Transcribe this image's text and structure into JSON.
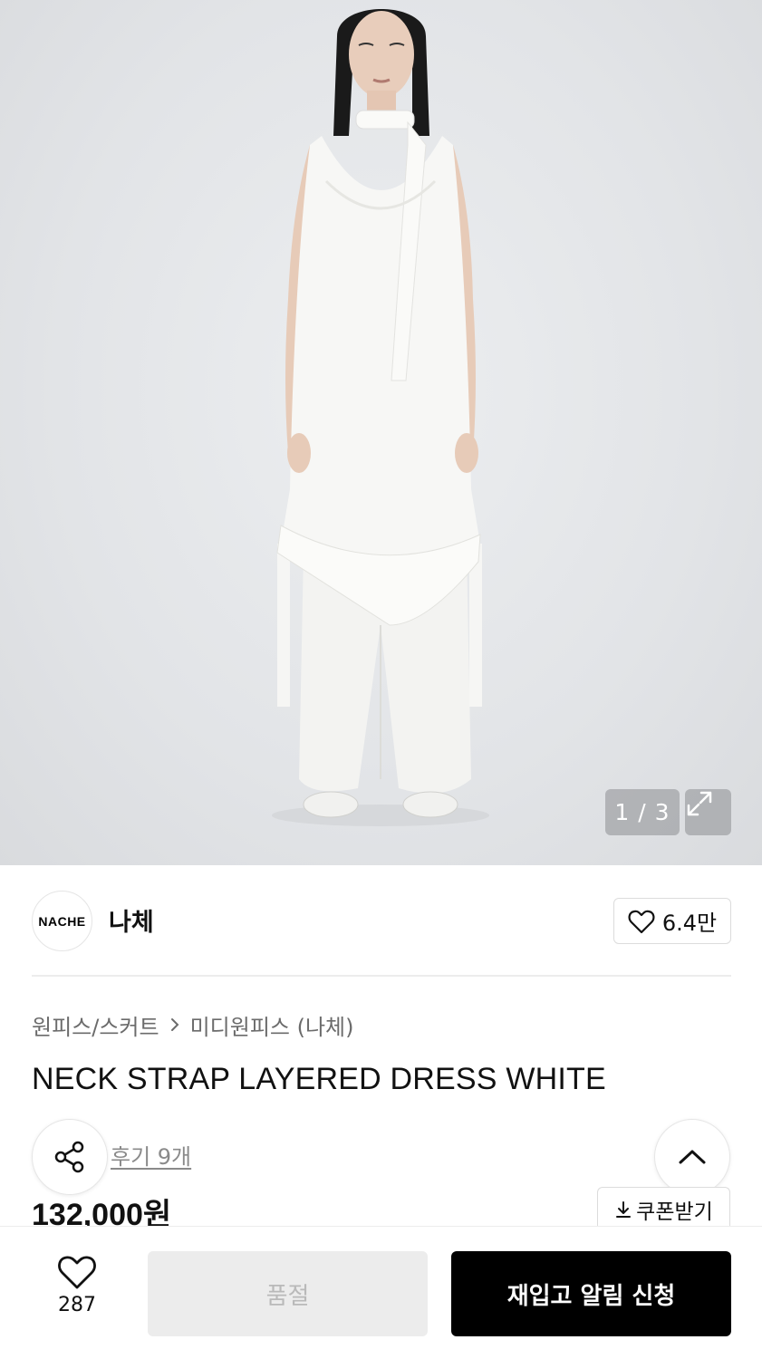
{
  "gallery": {
    "image_alt": "model wearing white layered dress with neck strap over wide white pants",
    "counter": "1 / 3",
    "expand_icon": "expand-icon"
  },
  "brand": {
    "logo_text": "NACHE",
    "name": "나체",
    "like_count": "6.4만",
    "like_icon": "heart-outline-icon"
  },
  "product": {
    "breadcrumb": [
      "원피스/스커트",
      "미디원피스 (나체)"
    ],
    "title": "NECK STRAP LAYERED DRESS WHITE",
    "review_link": "후기 9개",
    "price": "132,000원",
    "coupon_label": "쿠폰받기",
    "coupon_icon": "download-icon"
  },
  "floating": {
    "share_icon": "share-icon",
    "top_icon": "chevron-up-icon"
  },
  "bottom_bar": {
    "wish_count": "287",
    "soldout_label": "품절",
    "restock_label": "재입고 알림 신청"
  },
  "colors": {
    "primary_button": "#000000",
    "disabled_button": "#ececec",
    "muted_text": "#8a8a8a"
  }
}
